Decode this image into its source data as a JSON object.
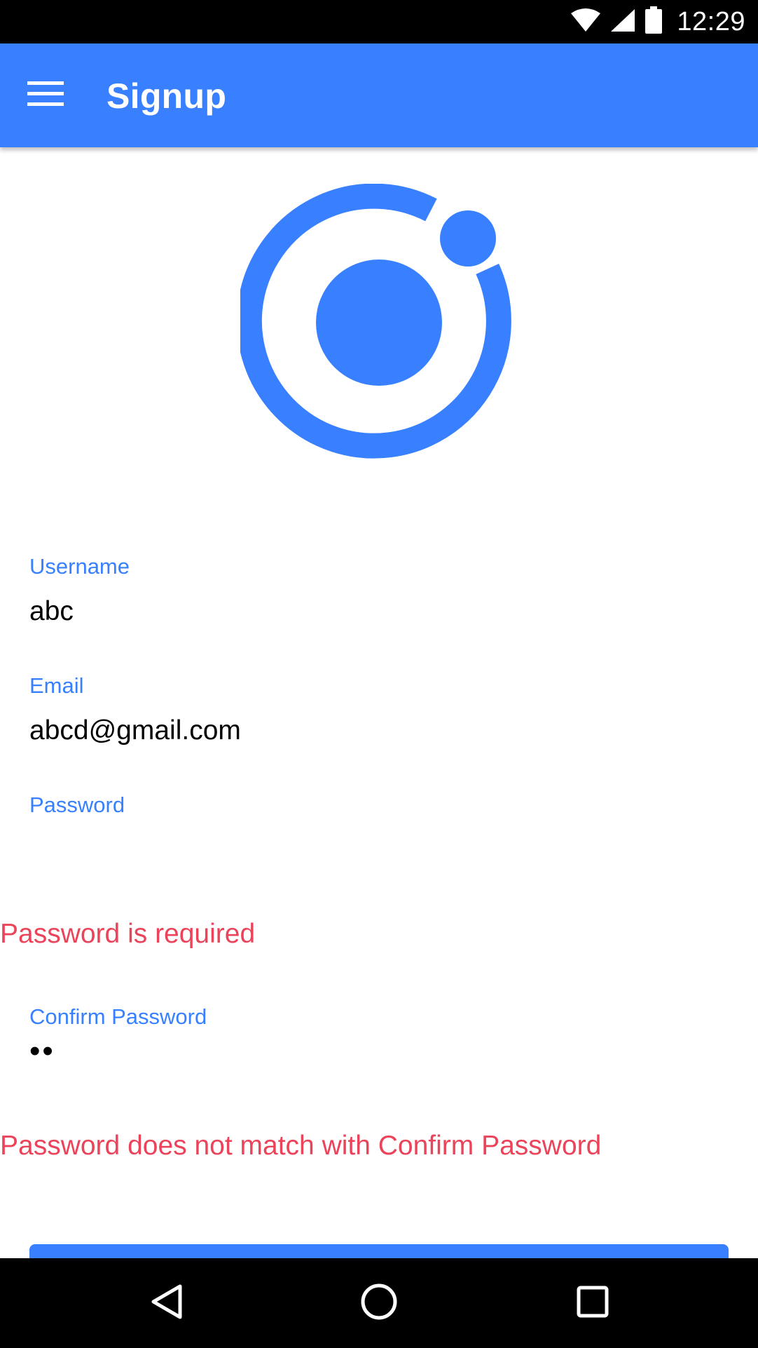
{
  "status_bar": {
    "time": "12:29",
    "icons": [
      "wifi-icon",
      "cellular-signal-icon",
      "battery-icon"
    ]
  },
  "toolbar": {
    "title": "Signup",
    "menu_icon": "hamburger-menu-icon",
    "background_color": "#3880ff"
  },
  "logo": {
    "icon": "ionic-logo",
    "color": "#3880ff"
  },
  "form": {
    "username": {
      "label": "Username",
      "value": "abc"
    },
    "email": {
      "label": "Email",
      "value": "abcd@gmail.com"
    },
    "password": {
      "label": "Password",
      "value": "",
      "error": "Password is required"
    },
    "confirm_password": {
      "label": "Confirm Password",
      "value": "••",
      "error": "Password does not match with Confirm Password"
    },
    "submit_label": ""
  },
  "colors": {
    "primary": "#3880ff",
    "danger": "#eb445a"
  },
  "nav_bar": {
    "icons": [
      "back-triangle-icon",
      "home-circle-icon",
      "recents-square-icon"
    ]
  }
}
